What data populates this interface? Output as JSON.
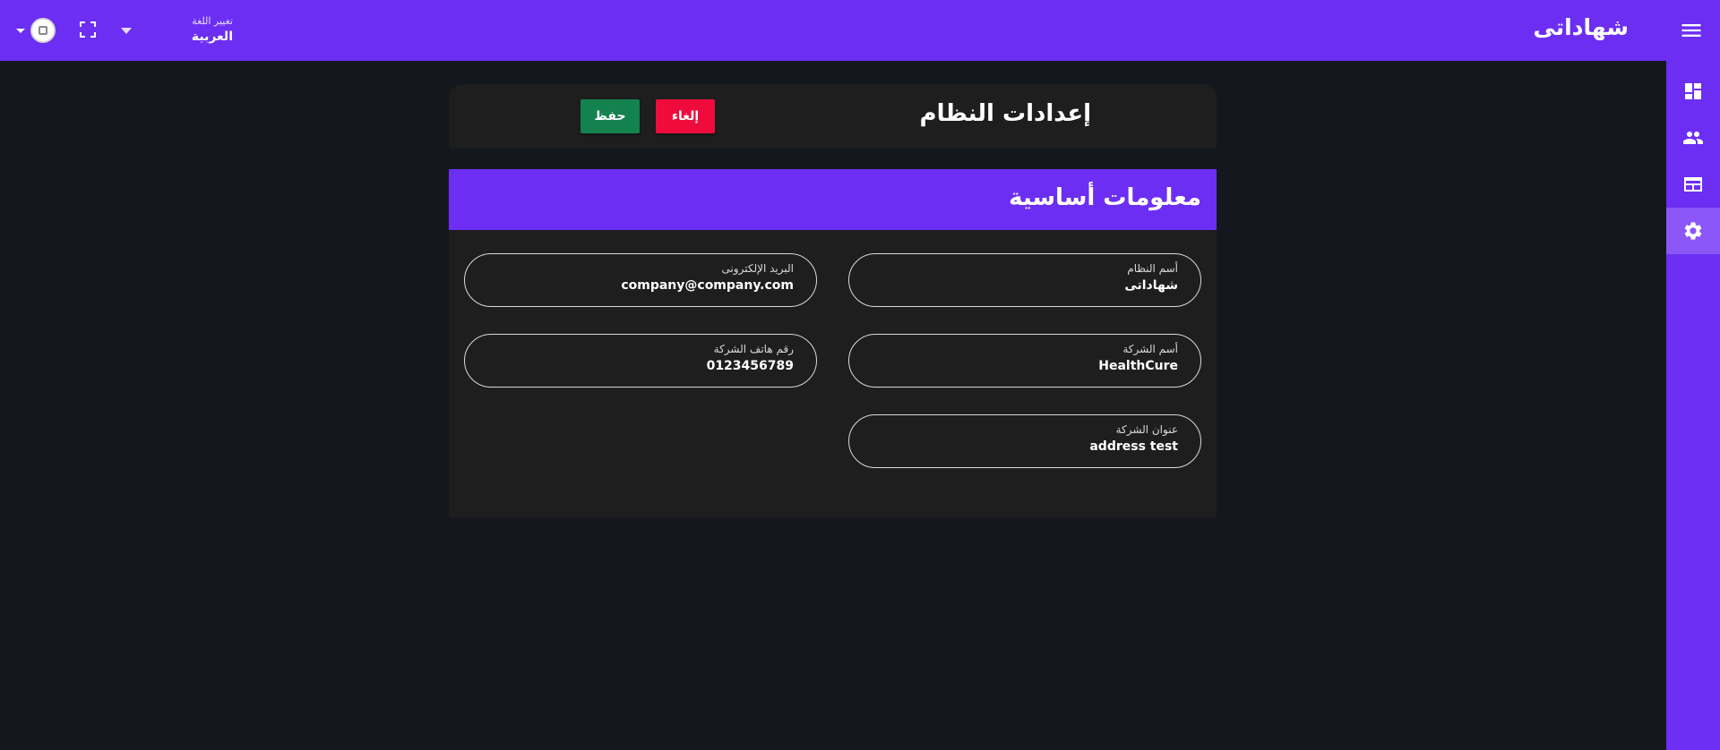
{
  "header": {
    "app_title": "شهاداتى",
    "language": {
      "caption": "تغيير اللغة",
      "value": "العربية"
    },
    "icons": {
      "menu": "menu-icon",
      "fullscreen": "fullscreen-icon",
      "language_dropdown": "caret-down-icon",
      "user_dropdown": "caret-down-icon",
      "avatar": "user-avatar"
    }
  },
  "sidebar": {
    "items": [
      {
        "name": "dashboard",
        "icon": "dashboard-icon",
        "active": false
      },
      {
        "name": "users",
        "icon": "people-icon",
        "active": false
      },
      {
        "name": "certificates",
        "icon": "table-icon",
        "active": false
      },
      {
        "name": "settings",
        "icon": "gear-icon",
        "active": true
      }
    ]
  },
  "page": {
    "title": "إعدادات النظام",
    "buttons": {
      "cancel": "إلغاء",
      "save": "حفظ"
    },
    "section_title": "معلومات أساسية",
    "fields": {
      "system_name": {
        "label": "أسم النظام",
        "value": "شهاداتى"
      },
      "email": {
        "label": "البريد الإلكترونى",
        "value": "company@company.com"
      },
      "company_name": {
        "label": "أسم الشركة",
        "value": "HealthCure"
      },
      "company_phone": {
        "label": "رقم هاتف الشركة",
        "value": "0123456789"
      },
      "company_address": {
        "label": "عنوان الشركة",
        "value": "address test"
      }
    }
  },
  "colors": {
    "primary": "#6c2ef2",
    "background": "#15171f",
    "card": "#1e1e1e",
    "cancel": "#f00b3d",
    "save": "#13824f"
  }
}
